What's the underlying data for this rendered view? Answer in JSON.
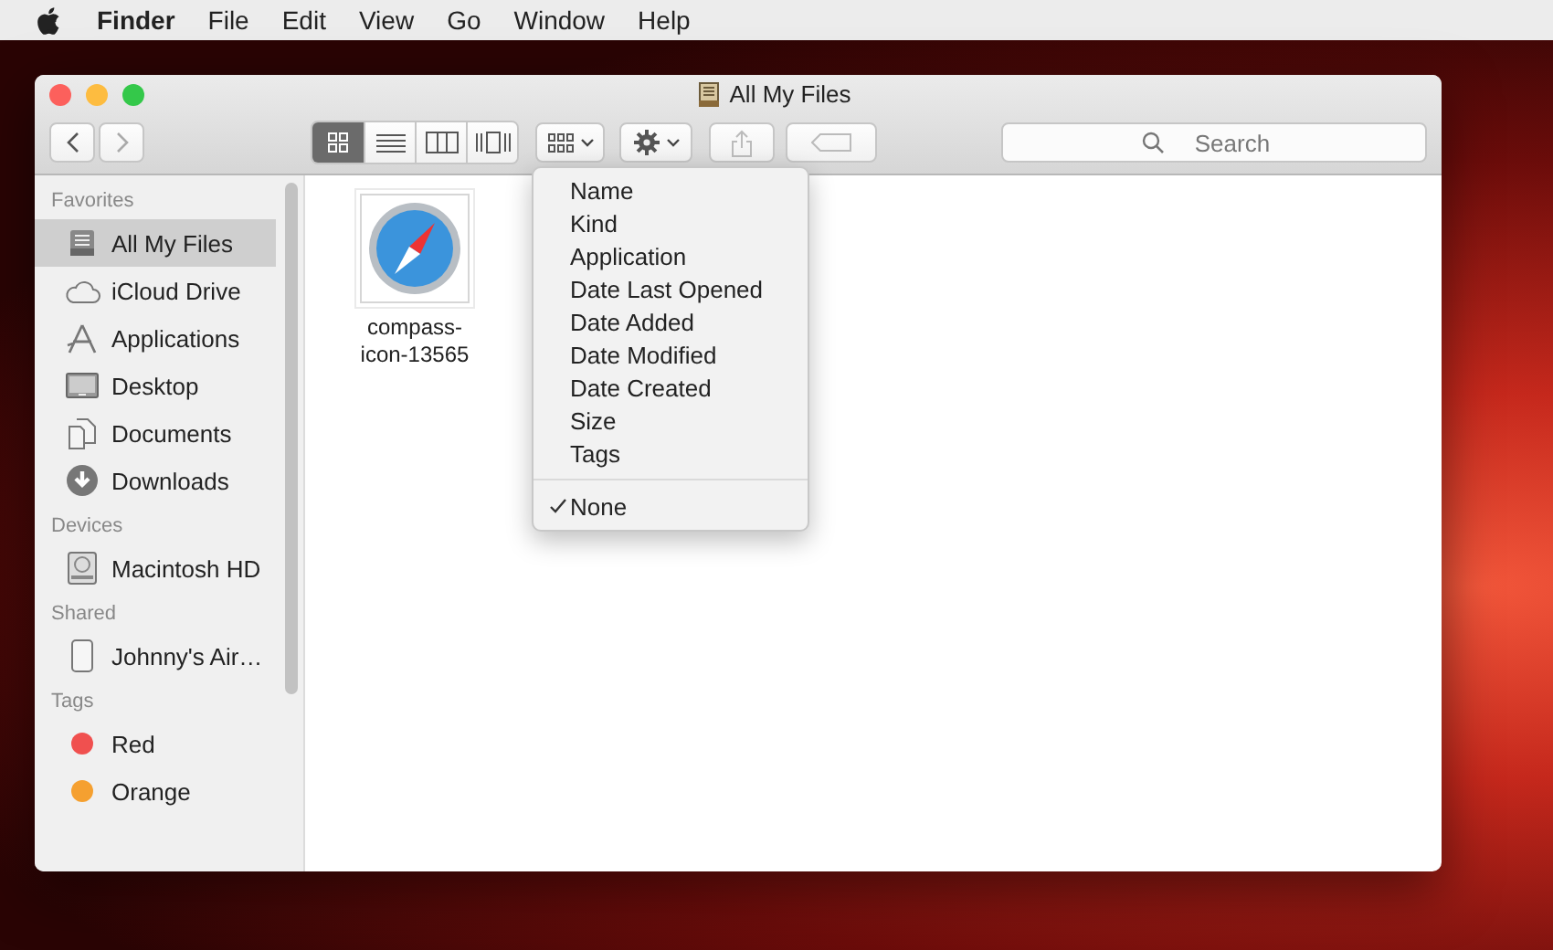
{
  "menu_bar": {
    "app_name": "Finder",
    "menus": [
      "File",
      "Edit",
      "View",
      "Go",
      "Window",
      "Help"
    ]
  },
  "window": {
    "title": "All My Files"
  },
  "toolbar": {
    "view_modes": [
      {
        "kind": "icon",
        "selected": true
      },
      {
        "kind": "list",
        "selected": false
      },
      {
        "kind": "column",
        "selected": false
      },
      {
        "kind": "coverflow",
        "selected": false
      }
    ],
    "search": {
      "placeholder": "Search"
    }
  },
  "sidebar": {
    "sections": [
      {
        "title": "Favorites",
        "items": [
          {
            "label": "All My Files",
            "kind": "files",
            "selected": true
          },
          {
            "label": "iCloud Drive",
            "kind": "cloud",
            "selected": false
          },
          {
            "label": "Applications",
            "kind": "apps",
            "selected": false
          },
          {
            "label": "Desktop",
            "kind": "desktop",
            "selected": false
          },
          {
            "label": "Documents",
            "kind": "documents",
            "selected": false
          },
          {
            "label": "Downloads",
            "kind": "downloads",
            "selected": false
          }
        ]
      },
      {
        "title": "Devices",
        "items": [
          {
            "label": "Macintosh HD",
            "kind": "disk",
            "selected": false
          }
        ]
      },
      {
        "title": "Shared",
        "items": [
          {
            "label": "Johnny's Air…",
            "kind": "phone",
            "selected": false
          }
        ]
      },
      {
        "title": "Tags",
        "items": [
          {
            "label": "Red",
            "kind": "tag",
            "color": "#f0504f",
            "selected": false
          },
          {
            "label": "Orange",
            "kind": "tag",
            "color": "#f5a030",
            "selected": false
          }
        ]
      }
    ]
  },
  "files": [
    {
      "name": "compass-icon-13565"
    }
  ],
  "arrange_menu": {
    "groups": [
      {
        "items": [
          {
            "label": "Name",
            "checked": false
          },
          {
            "label": "Kind",
            "checked": false
          },
          {
            "label": "Application",
            "checked": false
          },
          {
            "label": "Date Last Opened",
            "checked": false
          },
          {
            "label": "Date Added",
            "checked": false
          },
          {
            "label": "Date Modified",
            "checked": false
          },
          {
            "label": "Date Created",
            "checked": false
          },
          {
            "label": "Size",
            "checked": false
          },
          {
            "label": "Tags",
            "checked": false
          }
        ]
      },
      {
        "items": [
          {
            "label": "None",
            "checked": true
          }
        ]
      }
    ]
  }
}
